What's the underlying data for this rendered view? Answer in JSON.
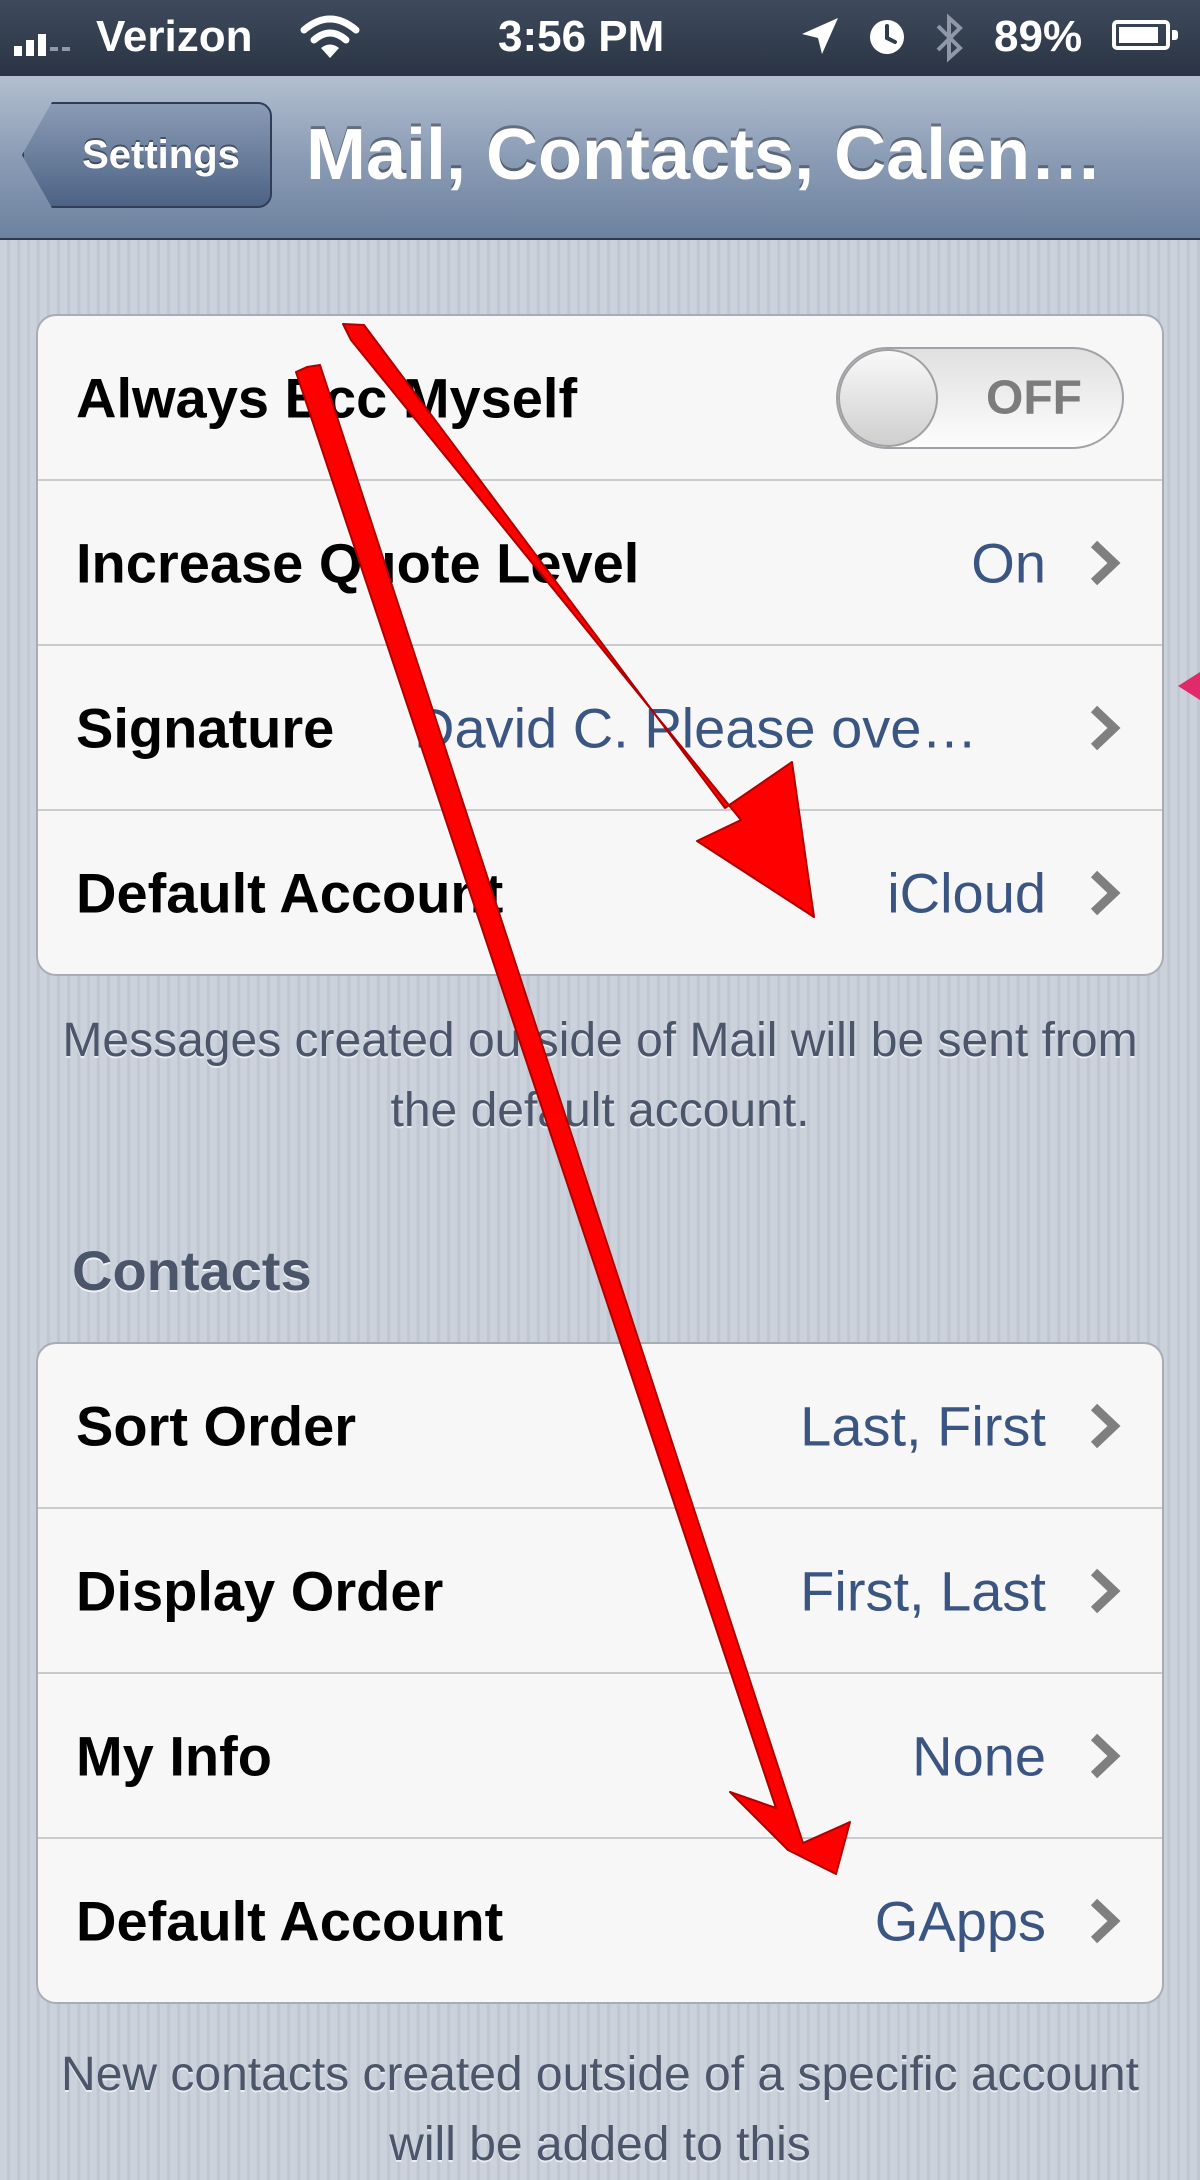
{
  "status_bar": {
    "carrier": "Verizon",
    "time": "3:56 PM",
    "battery_pct": "89%",
    "battery_level": 0.89,
    "icons": [
      "signal-icon",
      "wifi-icon",
      "location-icon",
      "alarm-clock-icon",
      "bluetooth-icon",
      "battery-icon"
    ]
  },
  "nav": {
    "back_label": "Settings",
    "title": "Mail, Contacts, Calen…"
  },
  "mail_group": {
    "rows": [
      {
        "label": "Always Bcc Myself",
        "toggle_text": "OFF",
        "toggle_state": "off"
      },
      {
        "label": "Increase Quote Level",
        "value": "On"
      },
      {
        "label": "Signature",
        "value": "David C. Please ove…"
      },
      {
        "label": "Default Account",
        "value": "iCloud"
      }
    ],
    "footer": "Messages created outside of Mail will be sent from the default account."
  },
  "contacts_group": {
    "header": "Contacts",
    "rows": [
      {
        "label": "Sort Order",
        "value": "Last, First"
      },
      {
        "label": "Display Order",
        "value": "First, Last"
      },
      {
        "label": "My Info",
        "value": "None"
      },
      {
        "label": "Default Account",
        "value": "GApps"
      }
    ],
    "footer": "New contacts created outside of a specific account will be added to this"
  },
  "colors": {
    "value_text": "#3b5583",
    "annotation_arrow": "#ff0000",
    "nav_bar": "#8b9cb5"
  }
}
